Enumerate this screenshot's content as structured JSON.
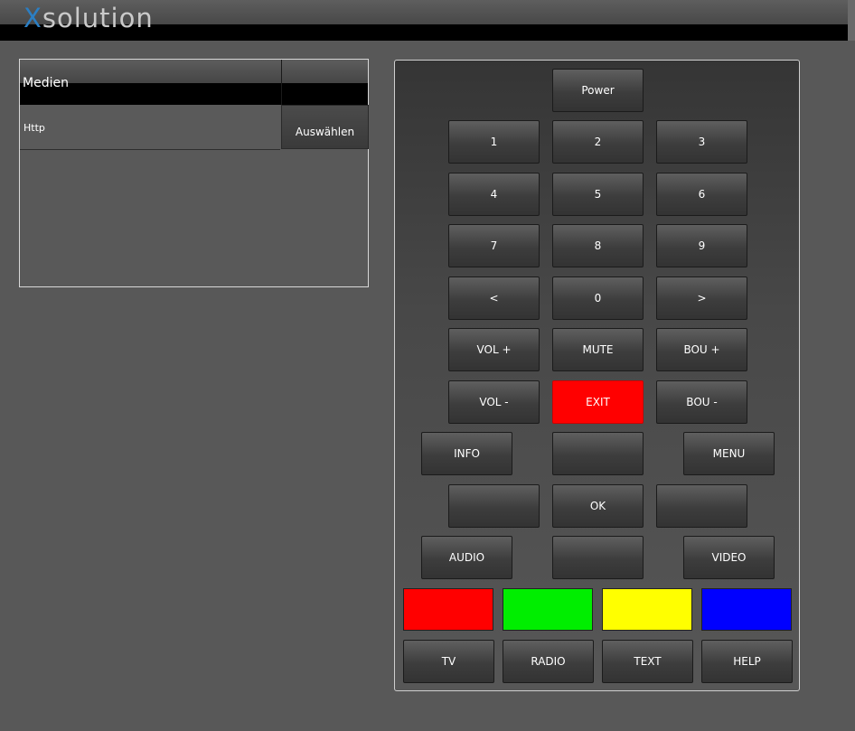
{
  "header": {
    "logo_prefix": "X",
    "logo_rest": "solution"
  },
  "media": {
    "title": "Medien",
    "rows": [
      {
        "label": "Http"
      }
    ],
    "select_label": "Auswählen"
  },
  "remote": {
    "power": "Power",
    "digits": [
      "1",
      "2",
      "3",
      "4",
      "5",
      "6",
      "7",
      "8",
      "9"
    ],
    "prev": "<",
    "zero": "0",
    "next": ">",
    "vol_up": "VOL +",
    "mute": "MUTE",
    "bou_up": "BOU +",
    "vol_down": "VOL -",
    "exit": "EXIT",
    "bou_down": "BOU -",
    "info": "INFO",
    "menu": "MENU",
    "ok": "OK",
    "audio": "AUDIO",
    "video": "VIDEO",
    "tv": "TV",
    "radio": "RADIO",
    "text": "TEXT",
    "help": "HELP",
    "colors": {
      "red": "#ff0000",
      "green": "#00ee00",
      "yellow": "#ffff00",
      "blue": "#0000ff",
      "exit": "#ff0000"
    }
  }
}
